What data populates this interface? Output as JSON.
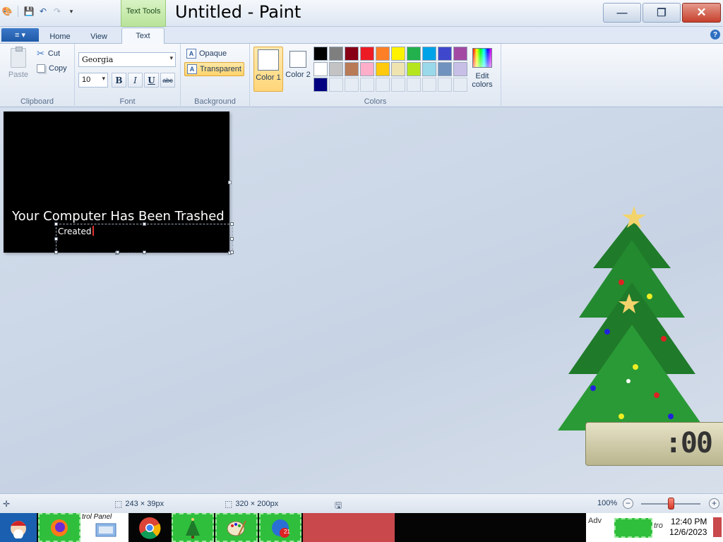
{
  "window": {
    "title": "Untitled - Paint",
    "context_tab": "Text Tools",
    "minimize_glyph": "—",
    "maximize_glyph": "❐",
    "close_glyph": "✕"
  },
  "tabs": {
    "file_icon": "≡ ▾",
    "home": "Home",
    "view": "View",
    "text": "Text",
    "help_glyph": "?"
  },
  "clipboard": {
    "paste": "Paste",
    "cut": "Cut",
    "copy": "Copy",
    "group_label": "Clipboard"
  },
  "font": {
    "family": "Georgia",
    "size": "10",
    "bold": "B",
    "italic": "I",
    "underline": "U",
    "strike": "abc",
    "group_label": "Font"
  },
  "background": {
    "opaque": "Opaque",
    "transparent": "Transparent",
    "icon_glyph": "A",
    "selected": "Transparent",
    "group_label": "Background"
  },
  "colors": {
    "color1_label": "Color 1",
    "color2_label": "Color 2",
    "color1_value": "#ffffff",
    "color2_value": "#ffffff",
    "edit_colors": "Edit colors",
    "group_label": "Colors",
    "palette": [
      "#000000",
      "#7f7f7f",
      "#880015",
      "#ed1c24",
      "#ff7f27",
      "#fff200",
      "#22b14c",
      "#00a2e8",
      "#3f48cc",
      "#a349a4",
      "#ffffff",
      "#c3c3c3",
      "#b97a57",
      "#ffaec9",
      "#ffc90e",
      "#efe4b0",
      "#b5e61d",
      "#99d9ea",
      "#7092be",
      "#c8bfe7",
      "#000080",
      "",
      "",
      "",
      "",
      "",
      "",
      "",
      "",
      ""
    ]
  },
  "canvas": {
    "heading_text": "Your Computer Has Been Trashed",
    "typing_text": "Created",
    "background_color": "#000000"
  },
  "desktop_widget": {
    "clock_digits": ":00"
  },
  "statusbar": {
    "cursor_icon": "✛",
    "selection_icon": "⬚",
    "selection_size": "243 × 39px",
    "canvas_icon": "⬚",
    "canvas_size": "320 × 200px",
    "save_icon": "🖫",
    "zoom_level": "100%",
    "zoom_fraction": 0.5,
    "zoom_minus": "−",
    "zoom_plus": "+"
  },
  "taskbar": {
    "items": [
      {
        "name": "santa-start-icon"
      },
      {
        "name": "firefox-icon"
      },
      {
        "name": "control-panel-icon",
        "label": "trol Panel"
      },
      {
        "name": "chrome-icon"
      },
      {
        "name": "christmas-tree-icon"
      },
      {
        "name": "paint-icon"
      },
      {
        "name": "messenger-icon",
        "badge": "21"
      }
    ],
    "tray_adv": "Adv",
    "tray_fragment": "tro",
    "time": "12:40 PM",
    "date": "12/6/2023"
  }
}
